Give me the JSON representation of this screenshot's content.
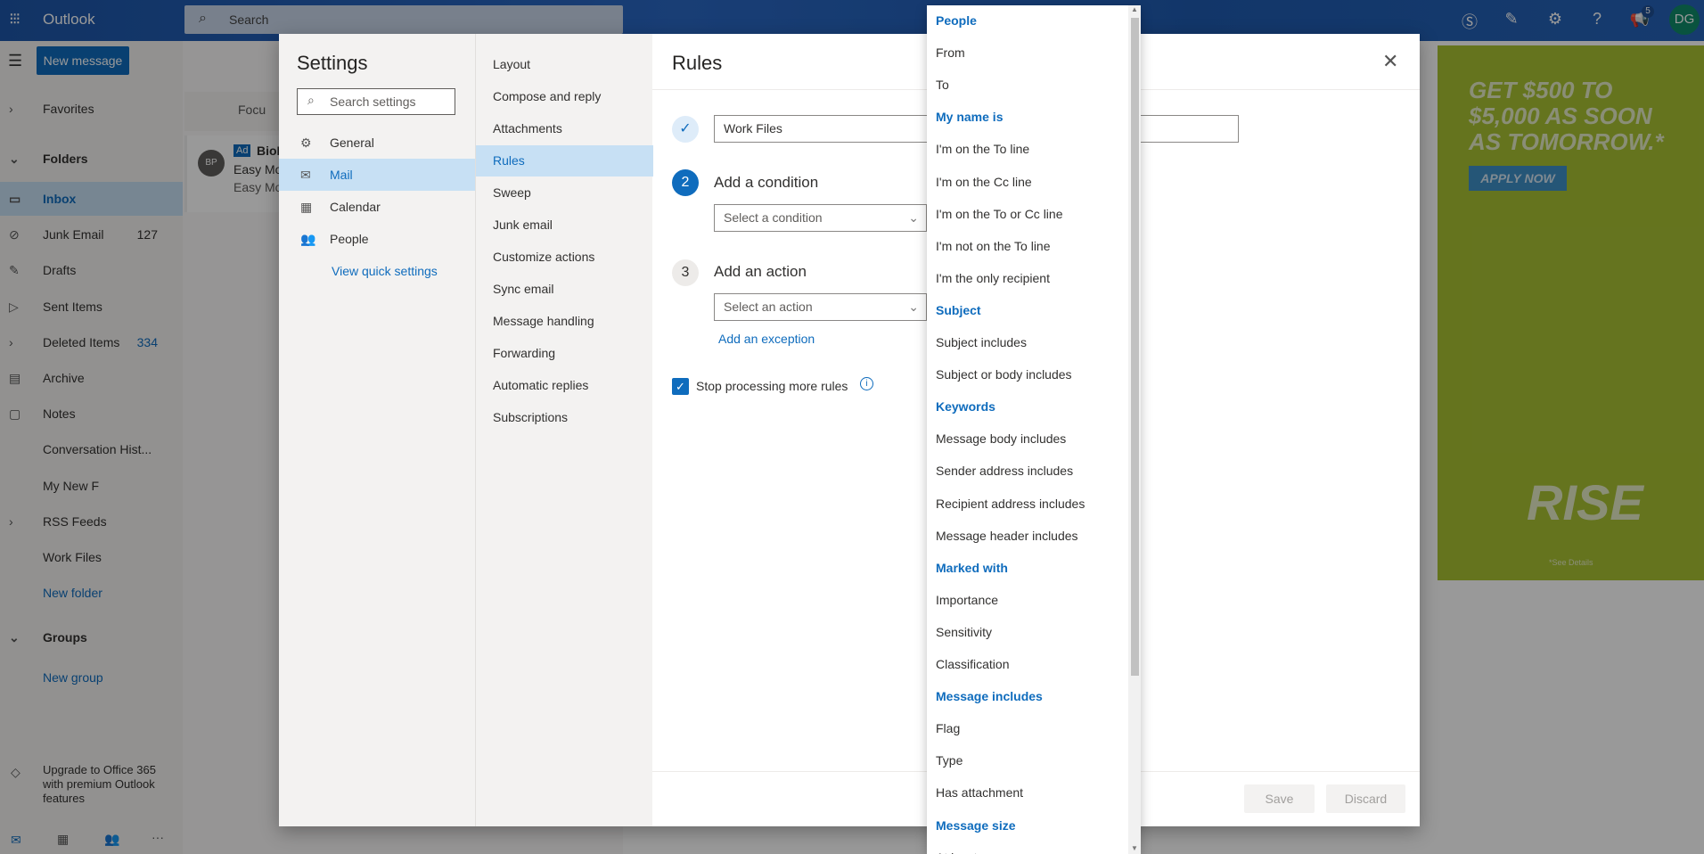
{
  "topbar": {
    "app_name": "Outlook",
    "search_placeholder": "Search",
    "notification_count": "5",
    "avatar_initials": "DG"
  },
  "nav": {
    "new_message": "New message",
    "favorites": "Favorites",
    "folders": "Folders",
    "items": [
      {
        "label": "Inbox",
        "count": ""
      },
      {
        "label": "Junk Email",
        "count": "127"
      },
      {
        "label": "Drafts",
        "count": ""
      },
      {
        "label": "Sent Items",
        "count": ""
      },
      {
        "label": "Deleted Items",
        "count": "334"
      },
      {
        "label": "Archive",
        "count": ""
      },
      {
        "label": "Notes",
        "count": ""
      },
      {
        "label": "Conversation Hist...",
        "count": ""
      },
      {
        "label": "My New F",
        "count": ""
      },
      {
        "label": "RSS Feeds",
        "count": ""
      },
      {
        "label": "Work Files",
        "count": ""
      }
    ],
    "new_folder": "New folder",
    "groups": "Groups",
    "new_group": "New group",
    "upgrade": "Upgrade to Office 365 with premium Outlook features"
  },
  "message_list": {
    "focused_tab": "Focu",
    "card": {
      "avatar": "BP",
      "ad_badge": "Ad",
      "sender": "BioL",
      "line1": "Easy Mo",
      "line2": "Easy Mo"
    }
  },
  "ad": {
    "headline": "GET $500 TO $5,000 AS SOON AS TOMORROW.*",
    "button": "APPLY NOW",
    "logo": "RISE",
    "see_details": "*See Details",
    "colors": {
      "background": "#a8c233"
    }
  },
  "settings": {
    "title": "Settings",
    "search_placeholder": "Search settings",
    "categories": [
      {
        "label": "General",
        "icon": "gear"
      },
      {
        "label": "Mail",
        "icon": "mail",
        "selected": true
      },
      {
        "label": "Calendar",
        "icon": "calendar"
      },
      {
        "label": "People",
        "icon": "people"
      }
    ],
    "view_quick_settings": "View quick settings",
    "mail_sections": [
      "Layout",
      "Compose and reply",
      "Attachments",
      "Rules",
      "Sweep",
      "Junk email",
      "Customize actions",
      "Sync email",
      "Message handling",
      "Forwarding",
      "Automatic replies",
      "Subscriptions"
    ],
    "selected_section": "Rules"
  },
  "rules": {
    "title": "Rules",
    "rule_name": "Work Files",
    "step2_number": "2",
    "step2_label": "Add a condition",
    "condition_placeholder": "Select a condition",
    "step3_number": "3",
    "step3_label": "Add an action",
    "action_placeholder": "Select an action",
    "add_exception": "Add an exception",
    "stop_processing": "Stop processing more rules",
    "stop_processing_checked": true,
    "save": "Save",
    "discard": "Discard"
  },
  "condition_dropdown": [
    {
      "label": "People",
      "header": true
    },
    {
      "label": "From"
    },
    {
      "label": "To"
    },
    {
      "label": "My name is",
      "header": true
    },
    {
      "label": "I'm on the To line"
    },
    {
      "label": "I'm on the Cc line"
    },
    {
      "label": "I'm on the To or Cc line"
    },
    {
      "label": "I'm not on the To line"
    },
    {
      "label": "I'm the only recipient"
    },
    {
      "label": "Subject",
      "header": true
    },
    {
      "label": "Subject includes"
    },
    {
      "label": "Subject or body includes"
    },
    {
      "label": "Keywords",
      "header": true
    },
    {
      "label": "Message body includes"
    },
    {
      "label": "Sender address includes"
    },
    {
      "label": "Recipient address includes"
    },
    {
      "label": "Message header includes"
    },
    {
      "label": "Marked with",
      "header": true
    },
    {
      "label": "Importance"
    },
    {
      "label": "Sensitivity"
    },
    {
      "label": "Classification"
    },
    {
      "label": "Message includes",
      "header": true
    },
    {
      "label": "Flag"
    },
    {
      "label": "Type"
    },
    {
      "label": "Has attachment"
    },
    {
      "label": "Message size",
      "header": true
    },
    {
      "label": "At least"
    }
  ],
  "colors": {
    "accent": "#0f6cbd",
    "selected_bg": "#c7e0f4"
  }
}
